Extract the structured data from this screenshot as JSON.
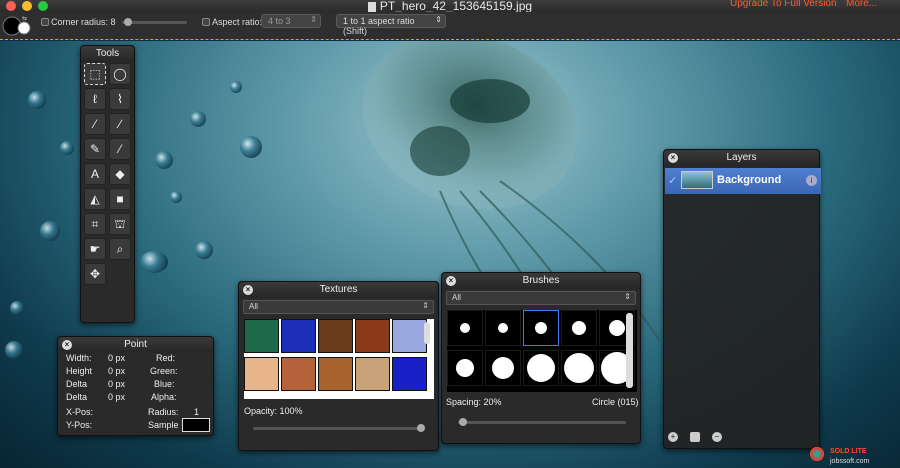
{
  "window": {
    "title": "PT_hero_42_153645159.jpg",
    "upgrade_label": "Upgrade To Full Version",
    "more_label": "More..."
  },
  "options": {
    "corner_radius_label": "Corner radius: 8",
    "aspect_ratio_label": "Aspect ratio:",
    "aspect_ratio_value": "4 to 3",
    "ratio_mode_value": "1 to 1 aspect ratio (Shift)"
  },
  "tools_panel": {
    "title": "Tools",
    "tools": [
      "rect-select",
      "ellipse-select",
      "lasso",
      "polygon-lasso",
      "magic-wand",
      "brush",
      "pencil",
      "eyedropper",
      "text",
      "eraser",
      "paint-bucket",
      "shape",
      "crop",
      "clone-stamp",
      "smudge",
      "zoom",
      "move"
    ]
  },
  "point_panel": {
    "title": "Point",
    "width_label": "Width:",
    "width_value": "0 px",
    "height_label": "Height",
    "height_value": "0 px",
    "delta1_label": "Delta",
    "delta1_value": "0 px",
    "delta2_label": "Delta",
    "delta2_value": "0 px",
    "xpos_label": "X-Pos:",
    "ypos_label": "Y-Pos:",
    "red_label": "Red:",
    "green_label": "Green:",
    "blue_label": "Blue:",
    "alpha_label": "Alpha:",
    "radius_label": "Radius:",
    "radius_value": "1",
    "sample_label": "Sample"
  },
  "textures_panel": {
    "title": "Textures",
    "filter_value": "All",
    "opacity_label": "Opacity: 100%",
    "swatch_colors": [
      "#1f6a4a",
      "#1d2fb8",
      "#6b3a1a",
      "#8a3a18",
      "#9aa8e0",
      "#e8b48a",
      "#b5623a",
      "#a8642e",
      "#c9a27a",
      "#1a20c8"
    ]
  },
  "brushes_panel": {
    "title": "Brushes",
    "filter_value": "All",
    "spacing_label": "Spacing: 20%",
    "brush_name": "Circle (015)"
  },
  "layers_panel": {
    "title": "Layers",
    "layer_name": "Background"
  },
  "watermark": {
    "line1": "SOLD LITE",
    "line2": "jobssoft.com"
  }
}
